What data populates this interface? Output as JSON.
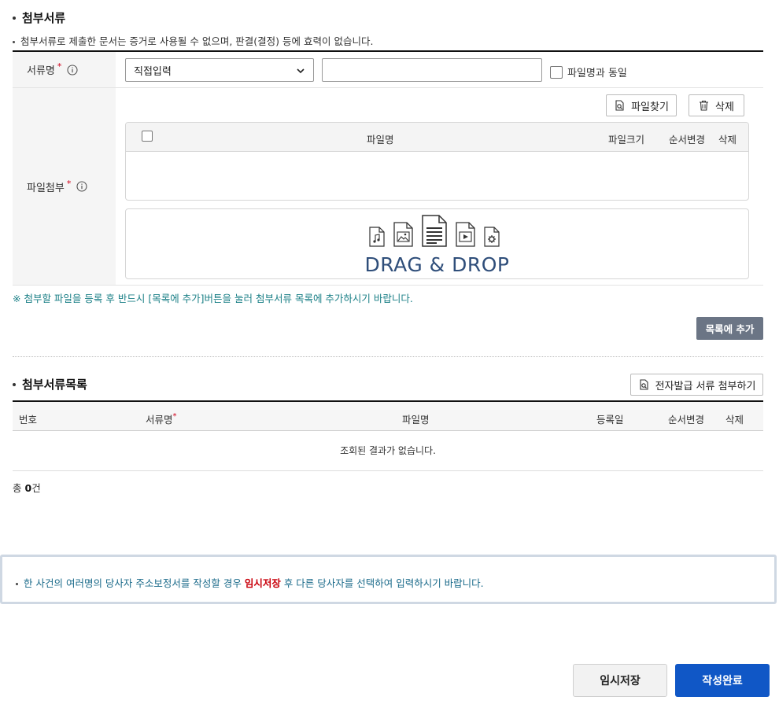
{
  "attach": {
    "title": "첨부서류",
    "note": "첨부서류로 제출한 문서는 증거로 사용될 수 없으며, 판결(결정) 등에 효력이 없습니다.",
    "doc_name_label": "서류명",
    "doc_type_select": "직접입력",
    "doc_name_input_value": "",
    "same_as_filename_label": "파일명과 동일",
    "file_attach_label": "파일첨부",
    "find_file_button": "파일찾기",
    "delete_button": "삭제",
    "file_table_headers": {
      "name": "파일명",
      "size": "파일크기",
      "order": "순서변경",
      "delete": "삭제"
    },
    "dropzone_text": "DRAG & DROP",
    "required_mark": "*"
  },
  "guide_note": "※ 첨부할 파일을 등록 후 반드시 [목록에 추가]버튼을 눌러 첨부서류 목록에 추가하시기 바랍니다.",
  "add_to_list_button": "목록에 추가",
  "attach_list": {
    "title": "첨부서류목록",
    "e_doc_button": "전자발급 서류 첨부하기",
    "headers": {
      "no": "번호",
      "doc_name": "서류명",
      "file_name": "파일명",
      "reg_date": "등록일",
      "order": "순서변경",
      "delete": "삭제"
    },
    "empty_message": "조회된 결과가 없습니다.",
    "total_prefix": "총 ",
    "total_count": "0",
    "total_suffix": "건"
  },
  "notice": {
    "before": "한 사건의 여러명의 당사자 주소보정서를 작성할 경우 ",
    "highlight": "임시저장",
    "after": " 후 다른 당사자를 선택하여 입력하시기 바랍니다."
  },
  "footer": {
    "temp_save_button": "임시저장",
    "complete_button": "작성완료"
  }
}
